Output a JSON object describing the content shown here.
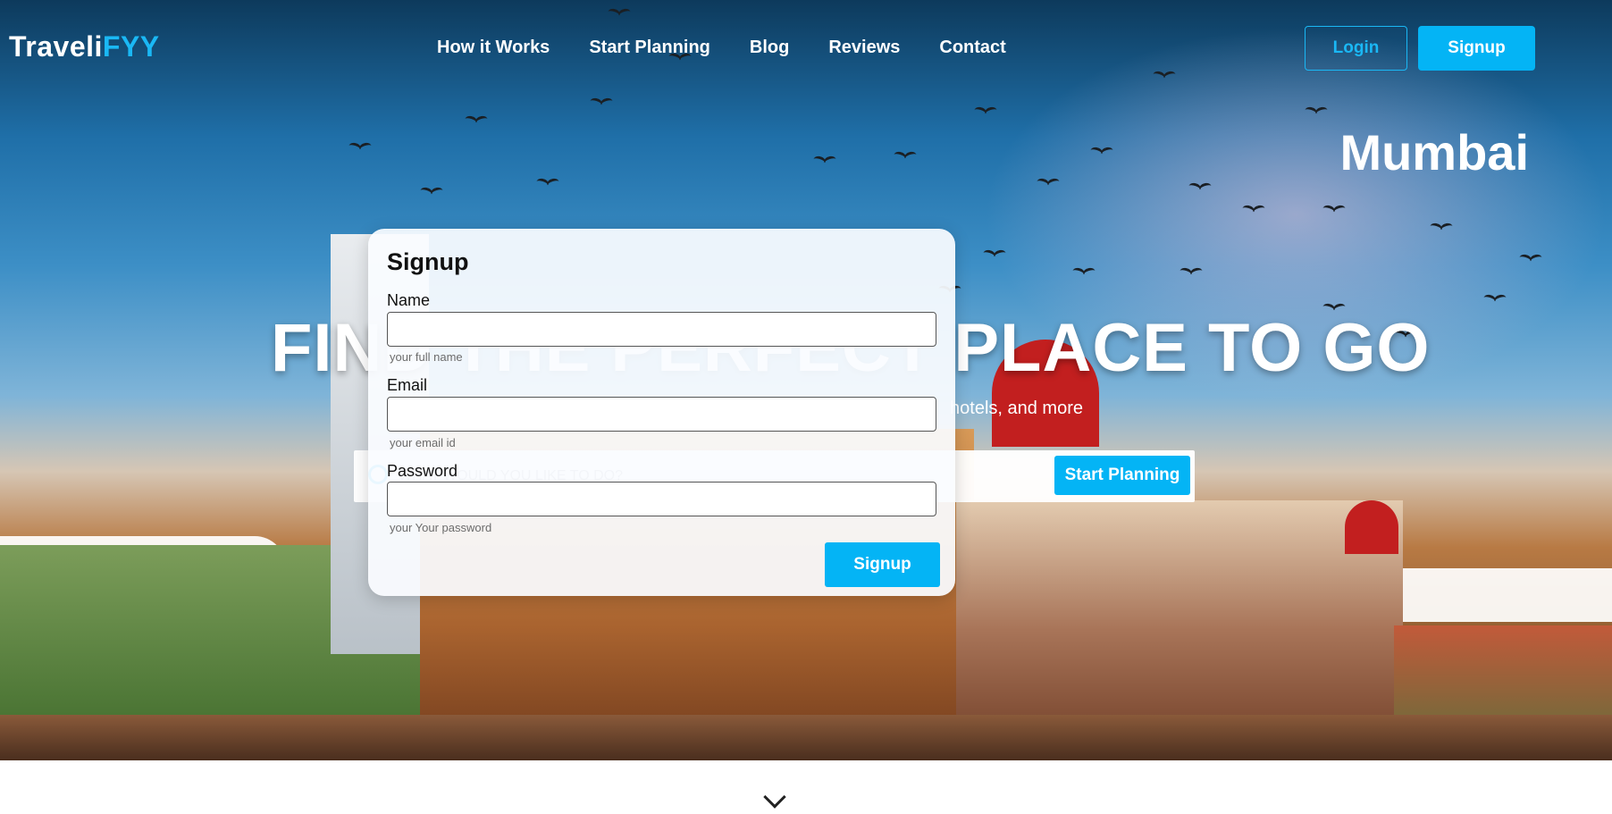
{
  "brand": {
    "name_main": "Traveli",
    "name_accent": "FYY",
    "accent_color": "#1ab8f5"
  },
  "nav": {
    "links": [
      "How it Works",
      "Start Planning",
      "Blog",
      "Reviews",
      "Contact"
    ],
    "login_label": "Login",
    "signup_label": "Signup"
  },
  "hero": {
    "city": "Mumbai",
    "title": "FIND THE PERFECT PLACE TO GO",
    "subtitle": "hotels, and more",
    "search_placeholder": "WHAT WOULD YOU LIKE TO DO?",
    "start_button": "Start Planning"
  },
  "signup_modal": {
    "title": "Signup",
    "fields": [
      {
        "label": "Name",
        "hint": "your full name",
        "value": ""
      },
      {
        "label": "Email",
        "hint": "your email id",
        "value": ""
      },
      {
        "label": "Password",
        "hint": "your Your password",
        "value": ""
      }
    ],
    "submit_label": "Signup"
  },
  "icons": {
    "scroll": "chevron-down-icon",
    "search": "search-icon"
  },
  "colors": {
    "primary_button": "#04b4f5",
    "text_light": "#ffffff"
  }
}
